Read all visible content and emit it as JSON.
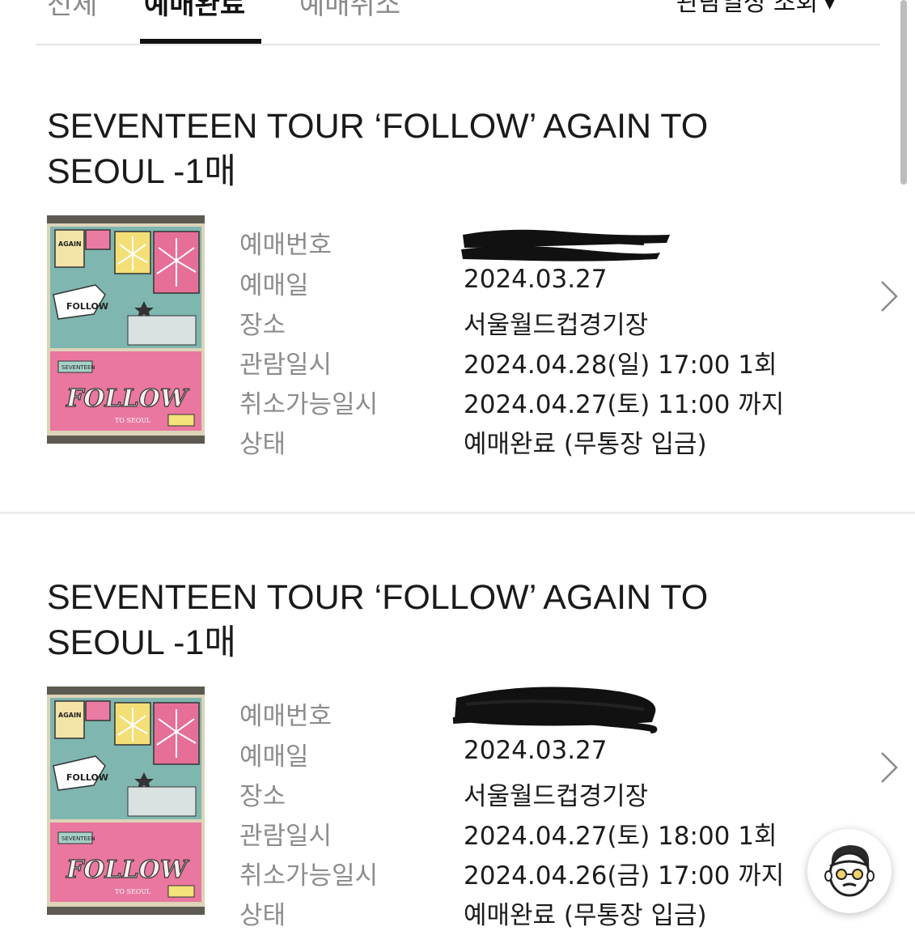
{
  "tabs": [
    {
      "label": "전체"
    },
    {
      "label": "예매완료"
    },
    {
      "label": "예매취소"
    }
  ],
  "date_filter": {
    "label": "관람일정 조회",
    "icon": "caret-down-icon"
  },
  "field_labels": {
    "booking_number": "예매번호",
    "booking_date": "예매일",
    "venue": "장소",
    "show_datetime": "관람일시",
    "cancel_deadline": "취소가능일시",
    "status": "상태"
  },
  "poster": {
    "text_main": "FOLLOW",
    "text_again": "AGAIN",
    "text_to": "TO SEOUL",
    "text_brand": "SEVENTEEN"
  },
  "bookings": [
    {
      "title": "SEVENTEEN TOUR ‘FOLLOW’ AGAIN TO SEOUL -1매",
      "booking_date": "2024.03.27",
      "venue": "서울월드컵경기장",
      "show_datetime": "2024.04.28(일) 17:00 1회",
      "cancel_deadline": "2024.04.27(토) 11:00 까지",
      "status": "예매완료 (무통장 입금)"
    },
    {
      "title": "SEVENTEEN TOUR ‘FOLLOW’ AGAIN TO SEOUL -1매",
      "booking_date": "2024.03.27",
      "venue": "서울월드컵경기장",
      "show_datetime": "2024.04.27(토) 18:00 1회",
      "cancel_deadline": "2024.04.26(금) 17:00 까지",
      "status": "예매완료 (무통장 입금)"
    }
  ],
  "colors": {
    "active_tab": "#111111",
    "label_gray": "#8c8c8c",
    "poster_teal": "#7fb6b0",
    "poster_pink": "#e76f9a"
  }
}
